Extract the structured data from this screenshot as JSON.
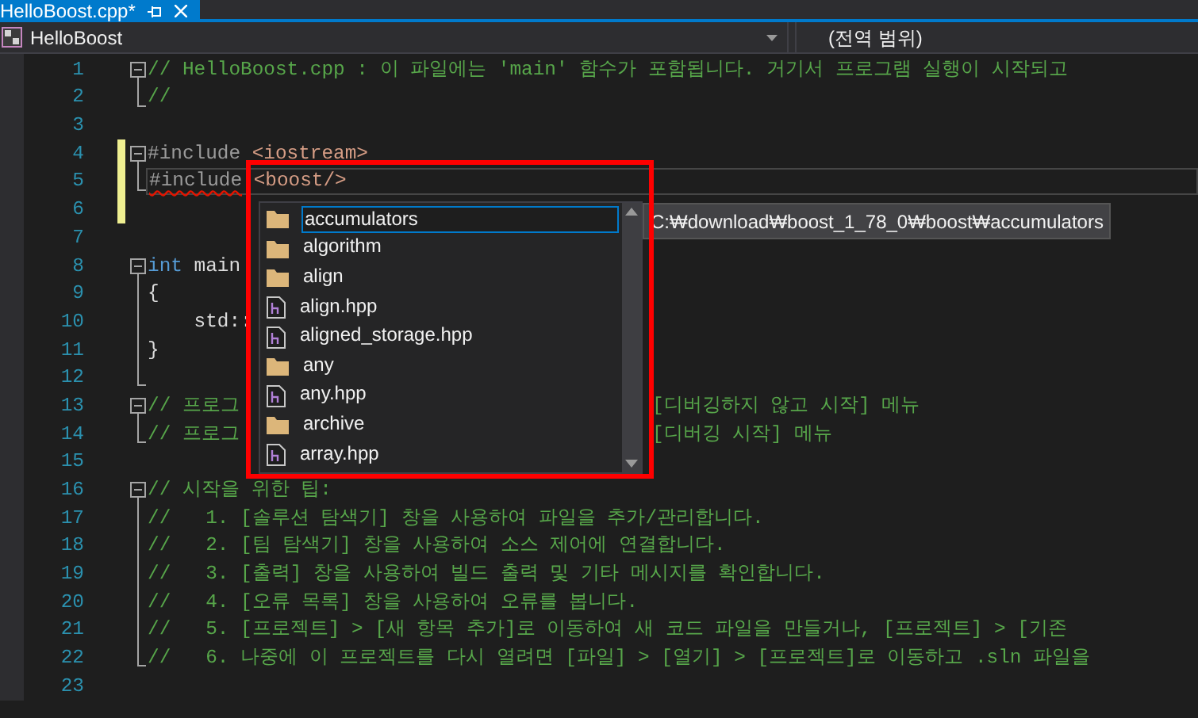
{
  "tab": {
    "title": "HelloBoost.cpp*",
    "selected": true
  },
  "nav": {
    "project": "HelloBoost",
    "scope": "(전역 범위)"
  },
  "lines": [
    {
      "number": "1",
      "kind": "fold-start",
      "changed": false,
      "left": [
        {
          "kind": "comment",
          "text": "// HelloBoost.cpp : 이 파일에는 'main' 함수가 포함됩니다. 거기서 프로그램 실행이 시작되고"
        }
      ]
    },
    {
      "number": "2",
      "kind": "fold-end",
      "changed": false,
      "left": [
        {
          "kind": "comment",
          "text": "//"
        }
      ]
    },
    {
      "number": "3",
      "kind": "plain",
      "changed": false
    },
    {
      "number": "4",
      "kind": "fold-start",
      "changed": true,
      "left": [
        {
          "kind": "preproc",
          "text": "#include"
        },
        {
          "kind": "string",
          "text": " <iostream>"
        }
      ]
    },
    {
      "number": "5",
      "kind": "fold-end",
      "changed": true,
      "current": true,
      "left": [
        {
          "kind": "preproc",
          "text": "#include",
          "error": true
        },
        {
          "kind": "string",
          "text": " <boost/>"
        }
      ]
    },
    {
      "number": "6",
      "kind": "plain",
      "changed": true
    },
    {
      "number": "7",
      "kind": "plain",
      "changed": false
    },
    {
      "number": "8",
      "kind": "fold-start",
      "changed": false,
      "left": [
        {
          "kind": "keyword",
          "text": "int"
        },
        {
          "kind": "plain",
          "text": " main"
        }
      ]
    },
    {
      "number": "9",
      "kind": "fold-body",
      "changed": false,
      "left": [
        {
          "kind": "plain",
          "text": "{"
        }
      ]
    },
    {
      "number": "10",
      "kind": "fold-body",
      "changed": false,
      "left": [
        {
          "kind": "plain",
          "text": "    std::"
        }
      ]
    },
    {
      "number": "11",
      "kind": "fold-body",
      "changed": false,
      "left": [
        {
          "kind": "plain",
          "text": "}"
        }
      ]
    },
    {
      "number": "12",
      "kind": "fold-end",
      "changed": false
    },
    {
      "number": "13",
      "kind": "fold-start",
      "changed": false,
      "left": [
        {
          "kind": "comment",
          "text": "// 프로그"
        }
      ],
      "right": [
        {
          "kind": "comment",
          "text": "[디버깅하지 않고 시작] 메뉴"
        }
      ]
    },
    {
      "number": "14",
      "kind": "fold-end",
      "changed": false,
      "left": [
        {
          "kind": "comment",
          "text": "// 프로그"
        }
      ],
      "right": [
        {
          "kind": "comment",
          "text": "[디버깅 시작] 메뉴"
        }
      ]
    },
    {
      "number": "15",
      "kind": "plain",
      "changed": false
    },
    {
      "number": "16",
      "kind": "fold-start",
      "changed": false,
      "left": [
        {
          "kind": "comment",
          "text": "// 시작을 위한 팁:"
        }
      ]
    },
    {
      "number": "17",
      "kind": "fold-body",
      "changed": false,
      "left": [
        {
          "kind": "comment",
          "text": "//   1. [솔루션 탐색기] 창을 사용하여 파일을 추가/관리합니다."
        }
      ]
    },
    {
      "number": "18",
      "kind": "fold-body",
      "changed": false,
      "left": [
        {
          "kind": "comment",
          "text": "//   2. [팀 탐색기] 창을 사용하여 소스 제어에 연결합니다."
        }
      ]
    },
    {
      "number": "19",
      "kind": "fold-body",
      "changed": false,
      "left": [
        {
          "kind": "comment",
          "text": "//   3. [출력] 창을 사용하여 빌드 출력 및 기타 메시지를 확인합니다."
        }
      ]
    },
    {
      "number": "20",
      "kind": "fold-body",
      "changed": false,
      "left": [
        {
          "kind": "comment",
          "text": "//   4. [오류 목록] 창을 사용하여 오류를 봅니다."
        }
      ]
    },
    {
      "number": "21",
      "kind": "fold-body",
      "changed": false,
      "left": [
        {
          "kind": "comment",
          "text": "//   5. [프로젝트] > [새 항목 추가]로 이동하여 새 코드 파일을 만들거나, [프로젝트] > [기존"
        }
      ]
    },
    {
      "number": "22",
      "kind": "fold-end",
      "changed": false,
      "left": [
        {
          "kind": "comment",
          "text": "//   6. 나중에 이 프로젝트를 다시 열려면 [파일] > [열기] > [프로젝트]로 이동하고 .sln 파일을"
        }
      ]
    },
    {
      "number": "23",
      "kind": "plain",
      "changed": false
    }
  ],
  "completion": {
    "items": [
      {
        "kind": "folder",
        "label": "accumulators",
        "selected": true
      },
      {
        "kind": "folder",
        "label": "algorithm",
        "selected": false
      },
      {
        "kind": "folder",
        "label": "align",
        "selected": false
      },
      {
        "kind": "header",
        "label": "align.hpp",
        "selected": false
      },
      {
        "kind": "header",
        "label": "aligned_storage.hpp",
        "selected": false
      },
      {
        "kind": "folder",
        "label": "any",
        "selected": false
      },
      {
        "kind": "header",
        "label": "any.hpp",
        "selected": false
      },
      {
        "kind": "folder",
        "label": "archive",
        "selected": false
      },
      {
        "kind": "header",
        "label": "array.hpp",
        "selected": false
      }
    ],
    "tooltip": "C:₩download₩boost_1_78_0₩boost₩accumulators"
  }
}
